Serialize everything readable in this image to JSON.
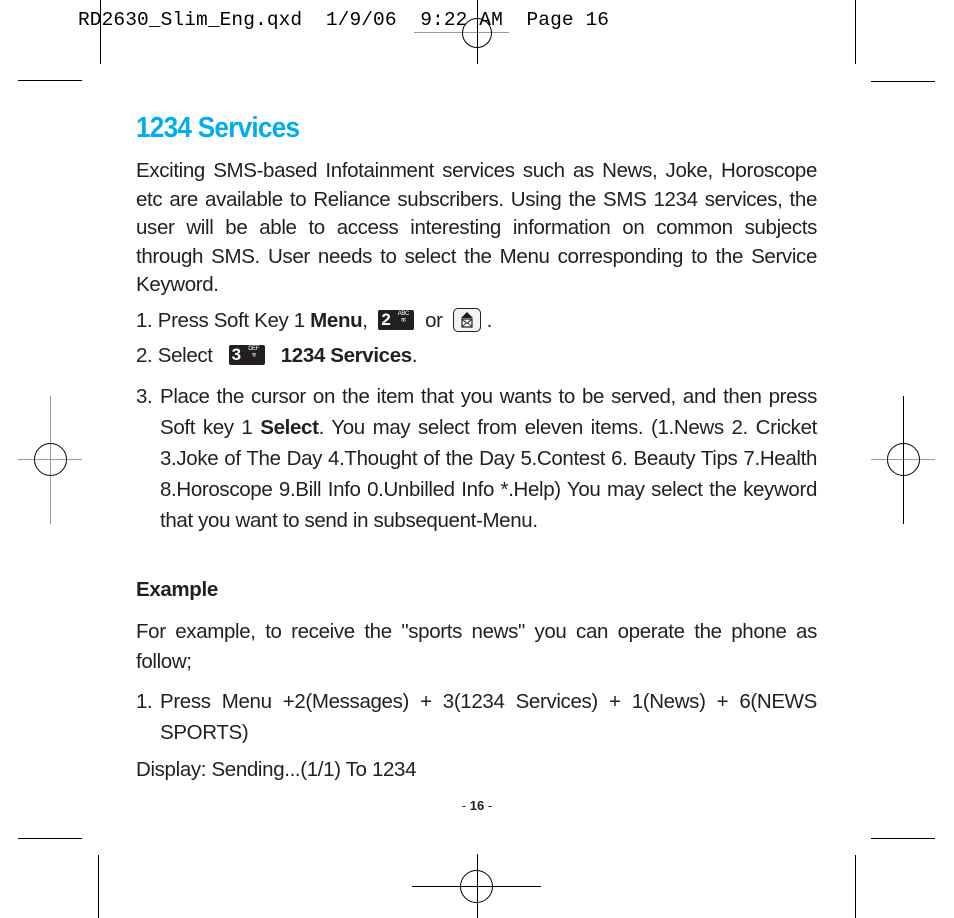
{
  "slug_line": "RD2630_Slim_Eng.qxd  1/9/06  9:22 AM  Page 16",
  "title": "1234 Services",
  "intro": "Exciting SMS-based Infotainment services such as News, Joke, Horoscope etc are available to Reliance subscribers. Using the SMS 1234 services, the user will be able to access interesting information on common subjects through SMS. User needs to select the Menu corresponding to the Service Keyword.",
  "step1": {
    "prefix": "1. Press Soft Key 1 ",
    "bold": "Menu",
    "comma": ",",
    "key1": {
      "icon": "key-2-abc-icon",
      "digit": "2",
      "letters": "ABC",
      "sub": "क"
    },
    "or": "or",
    "key2": {
      "icon": "message-key-icon"
    },
    "end": "."
  },
  "step2": {
    "prefix": "2. Select",
    "key": {
      "icon": "key-3-def-icon",
      "digit": "3",
      "letters": "DEF",
      "sub": "च"
    },
    "bold": "1234 Services",
    "end": "."
  },
  "step3": {
    "num": "3.",
    "text_a": "Place the cursor on the item that you wants to be served, and then press Soft key 1 ",
    "bold": "Select",
    "text_b": ". You may select from eleven items. (1.News 2. Cricket 3.Joke of The Day 4.Thought of the Day 5.Contest 6. Beauty Tips 7.Health 8.Horoscope 9.Bill Info 0.Unbilled Info *.Help) You may select the keyword that you want to send in subsequent-Menu."
  },
  "example": {
    "heading": "Example",
    "text": "For example, to receive the \"sports news\" you can operate the phone as follow;",
    "step_num": "1.",
    "step_text": "Press Menu +2(Messages) + 3(1234 Services) + 1(News) + 6(NEWS SPORTS)",
    "display": "Display: Sending...(1/1) To 1234"
  },
  "page_number": {
    "dash_left": "- ",
    "number": "16",
    "dash_right": " -"
  },
  "colors": {
    "title": "#00aeef",
    "text": "#231f20"
  }
}
